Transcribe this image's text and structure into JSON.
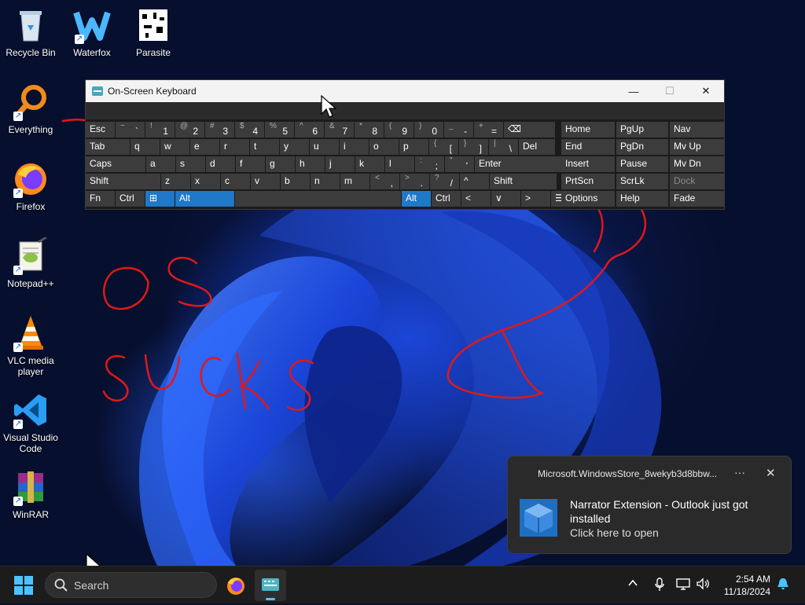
{
  "desktop": {
    "icons": [
      {
        "label": "Recycle Bin",
        "icon": "recycle-bin-icon"
      },
      {
        "label": "Waterfox",
        "icon": "waterfox-icon"
      },
      {
        "label": "Parasite",
        "icon": "parasite-icon"
      },
      {
        "label": "Everything",
        "icon": "everything-search-icon"
      },
      {
        "label": "Firefox",
        "icon": "firefox-icon"
      },
      {
        "label": "Notepad++",
        "icon": "notepadpp-icon"
      },
      {
        "label": "VLC media player",
        "icon": "vlc-icon"
      },
      {
        "label": "Visual Studio Code",
        "icon": "vscode-icon"
      },
      {
        "label": "WinRAR",
        "icon": "winrar-icon"
      }
    ]
  },
  "osk": {
    "title": "On-Screen Keyboard",
    "minimize": "—",
    "maximize": "☐",
    "close": "✕",
    "rows": [
      [
        {
          "label": "Esc"
        },
        {
          "shift": "~",
          "label": "`"
        },
        {
          "shift": "!",
          "label": "1"
        },
        {
          "shift": "@",
          "label": "2"
        },
        {
          "shift": "#",
          "label": "3"
        },
        {
          "shift": "$",
          "label": "4"
        },
        {
          "shift": "%",
          "label": "5"
        },
        {
          "shift": "^",
          "label": "6"
        },
        {
          "shift": "&",
          "label": "7"
        },
        {
          "shift": "*",
          "label": "8"
        },
        {
          "shift": "(",
          "label": "9"
        },
        {
          "shift": ")",
          "label": "0"
        },
        {
          "shift": "_",
          "label": "-"
        },
        {
          "shift": "+",
          "label": "="
        },
        {
          "label": "⌫"
        }
      ],
      [
        {
          "label": "Tab"
        },
        {
          "label": "q"
        },
        {
          "label": "w"
        },
        {
          "label": "e"
        },
        {
          "label": "r"
        },
        {
          "label": "t"
        },
        {
          "label": "y"
        },
        {
          "label": "u"
        },
        {
          "label": "i"
        },
        {
          "label": "o"
        },
        {
          "label": "p"
        },
        {
          "shift": "{",
          "label": "["
        },
        {
          "shift": "}",
          "label": "]"
        },
        {
          "shift": "|",
          "label": "\\"
        },
        {
          "label": "Del"
        }
      ],
      [
        {
          "label": "Caps"
        },
        {
          "label": "a"
        },
        {
          "label": "s"
        },
        {
          "label": "d"
        },
        {
          "label": "f"
        },
        {
          "label": "g"
        },
        {
          "label": "h"
        },
        {
          "label": "j"
        },
        {
          "label": "k"
        },
        {
          "label": "l"
        },
        {
          "shift": ":",
          "label": ";"
        },
        {
          "shift": "\"",
          "label": "'"
        },
        {
          "label": "Enter"
        }
      ],
      [
        {
          "label": "Shift"
        },
        {
          "label": "z"
        },
        {
          "label": "x"
        },
        {
          "label": "c"
        },
        {
          "label": "v"
        },
        {
          "label": "b"
        },
        {
          "label": "n"
        },
        {
          "label": "m"
        },
        {
          "shift": "<",
          "label": ","
        },
        {
          "shift": ">",
          "label": "."
        },
        {
          "shift": "?",
          "label": "/"
        },
        {
          "label": "^"
        },
        {
          "label": "Shift"
        }
      ],
      [
        {
          "label": "Fn"
        },
        {
          "label": "Ctrl"
        },
        {
          "label": "⊞"
        },
        {
          "label": "Alt"
        },
        {
          "label": ""
        },
        {
          "label": "Alt"
        },
        {
          "label": "Ctrl"
        },
        {
          "label": "<"
        },
        {
          "label": "∨"
        },
        {
          "label": ">"
        },
        {
          "label": "☰"
        }
      ]
    ],
    "nav_rows": [
      [
        "Home",
        "PgUp",
        "Nav"
      ],
      [
        "End",
        "PgDn",
        "Mv Up"
      ],
      [
        "Insert",
        "Pause",
        "Mv Dn"
      ],
      [
        "PrtScn",
        "ScrLk",
        "Dock"
      ],
      [
        "Options",
        "Help",
        "Fade"
      ]
    ]
  },
  "notification": {
    "source": "Microsoft.WindowsStore_8wekyb3d8bbw...",
    "more": "···",
    "close": "✕",
    "title": "Narrator Extension - Outlook just got installed",
    "subtitle": "Click here to open"
  },
  "taskbar": {
    "search_placeholder": "Search",
    "time": "2:54 AM",
    "date": "11/18/2024"
  },
  "scribble_text": {
    "os": "OS",
    "sucks": "SUCKS"
  }
}
